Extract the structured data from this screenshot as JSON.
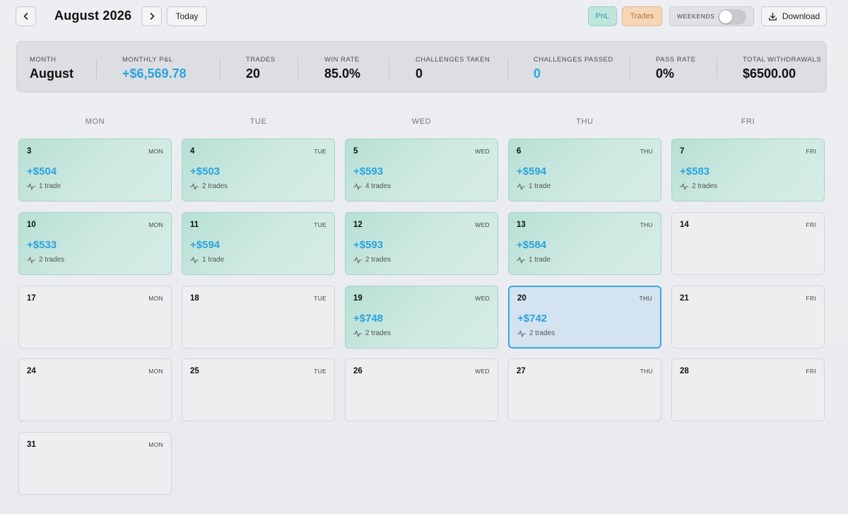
{
  "header": {
    "month_title": "August 2026",
    "today_label": "Today",
    "pnl_label": "PnL",
    "trades_label": "Trades",
    "weekends_label": "WEEKENDS",
    "weekends_on": false,
    "download_label": "Download",
    "icons": {
      "prev": "chevron-left-icon",
      "next": "chevron-right-icon",
      "download": "download-icon"
    }
  },
  "stats": [
    {
      "label": "Month",
      "value": "August",
      "color": "#111111"
    },
    {
      "label": "Monthly P&L",
      "value": "+$6,569.78",
      "color": "#2aa3e0"
    },
    {
      "label": "Trades",
      "value": "20",
      "color": "#111111"
    },
    {
      "label": "Win Rate",
      "value": "85.0%",
      "color": "#111111"
    },
    {
      "label": "Challenges Taken",
      "value": "0",
      "color": "#111111"
    },
    {
      "label": "Challenges Passed",
      "value": "0",
      "color": "#2aa3e0"
    },
    {
      "label": "Pass Rate",
      "value": "0%",
      "color": "#111111"
    },
    {
      "label": "Total Withdrawals",
      "value": "$6500.00",
      "color": "#111111"
    }
  ],
  "weekdays": [
    "MON",
    "TUE",
    "WED",
    "THU",
    "FRI"
  ],
  "days": [
    {
      "date": "3",
      "dow": "MON",
      "pnl": "+$504",
      "trades": "1 trade"
    },
    {
      "date": "4",
      "dow": "TUE",
      "pnl": "+$503",
      "trades": "2 trades"
    },
    {
      "date": "5",
      "dow": "WED",
      "pnl": "+$593",
      "trades": "4 trades"
    },
    {
      "date": "6",
      "dow": "THU",
      "pnl": "+$594",
      "trades": "1 trade"
    },
    {
      "date": "7",
      "dow": "FRI",
      "pnl": "+$583",
      "trades": "2 trades"
    },
    {
      "date": "10",
      "dow": "MON",
      "pnl": "+$533",
      "trades": "2 trades"
    },
    {
      "date": "11",
      "dow": "TUE",
      "pnl": "+$594",
      "trades": "1 trade"
    },
    {
      "date": "12",
      "dow": "WED",
      "pnl": "+$593",
      "trades": "2 trades"
    },
    {
      "date": "13",
      "dow": "THU",
      "pnl": "+$584",
      "trades": "1 trade"
    },
    {
      "date": "14",
      "dow": "FRI",
      "pnl": "",
      "trades": ""
    },
    {
      "date": "17",
      "dow": "MON",
      "pnl": "",
      "trades": ""
    },
    {
      "date": "18",
      "dow": "TUE",
      "pnl": "",
      "trades": ""
    },
    {
      "date": "19",
      "dow": "WED",
      "pnl": "+$748",
      "trades": "2 trades"
    },
    {
      "date": "20",
      "dow": "THU",
      "pnl": "+$742",
      "trades": "2 trades",
      "today": true
    },
    {
      "date": "21",
      "dow": "FRI",
      "pnl": "",
      "trades": ""
    },
    {
      "date": "24",
      "dow": "MON",
      "pnl": "",
      "trades": ""
    },
    {
      "date": "25",
      "dow": "TUE",
      "pnl": "",
      "trades": ""
    },
    {
      "date": "26",
      "dow": "WED",
      "pnl": "",
      "trades": ""
    },
    {
      "date": "27",
      "dow": "THU",
      "pnl": "",
      "trades": ""
    },
    {
      "date": "28",
      "dow": "FRI",
      "pnl": "",
      "trades": ""
    },
    {
      "date": "31",
      "dow": "MON",
      "pnl": "",
      "trades": ""
    }
  ]
}
